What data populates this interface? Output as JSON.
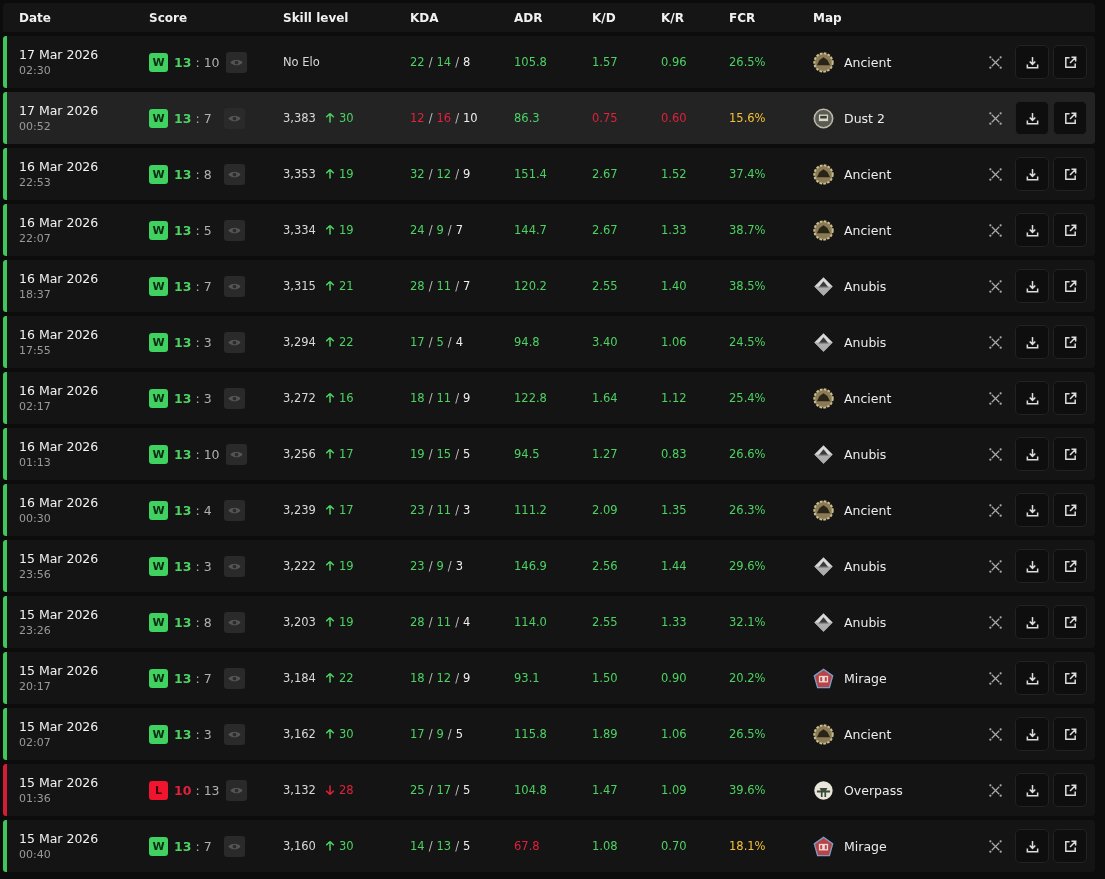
{
  "columns": [
    "Date",
    "Score",
    "Skill level",
    "KDA",
    "ADR",
    "K/D",
    "K/R",
    "FCR",
    "Map"
  ],
  "rows": [
    {
      "selected": false,
      "date": "17 Mar 2026",
      "time": "02:30",
      "result": "W",
      "win": true,
      "score": [
        {
          "text": "13",
          "color": "#4cd263"
        },
        {
          "text": ":"
        },
        {
          "text": "10"
        }
      ],
      "elo": "No Elo",
      "kda": [
        {
          "text": "22",
          "color": "#4cd263"
        },
        {
          "text": "/"
        },
        {
          "text": "14",
          "color": "#4cd263"
        },
        {
          "text": "/"
        },
        {
          "text": "8",
          "color": "#eeeeee"
        }
      ],
      "adr": {
        "text": "105.8",
        "color": "#4cd263"
      },
      "kd": {
        "text": "1.57",
        "color": "#4cd263"
      },
      "kr": {
        "text": "0.96",
        "color": "#4cd263"
      },
      "fcr": {
        "text": "26.5%",
        "color": "#4cd263"
      },
      "map": {
        "name": "Ancient",
        "kind": "ancient"
      }
    },
    {
      "selected": true,
      "date": "17 Mar 2026",
      "time": "00:52",
      "result": "W",
      "win": true,
      "score": [
        {
          "text": "13",
          "color": "#4cd263"
        },
        {
          "text": ":"
        },
        {
          "text": "7"
        }
      ],
      "elo": "3,383",
      "rising": true,
      "change": "30",
      "kda": [
        {
          "text": "12",
          "color": "#e0213d"
        },
        {
          "text": "/"
        },
        {
          "text": "16",
          "color": "#e0213d"
        },
        {
          "text": "/"
        },
        {
          "text": "10",
          "color": "#eeeeee"
        }
      ],
      "adr": {
        "text": "86.3",
        "color": "#4cd263"
      },
      "kd": {
        "text": "0.75",
        "color": "#e0213d"
      },
      "kr": {
        "text": "0.60",
        "color": "#e0213d"
      },
      "fcr": {
        "text": "15.6%",
        "color": "#f4c136"
      },
      "map": {
        "name": "Dust 2",
        "kind": "dust2"
      }
    },
    {
      "selected": false,
      "date": "16 Mar 2026",
      "time": "22:53",
      "result": "W",
      "win": true,
      "score": [
        {
          "text": "13",
          "color": "#4cd263"
        },
        {
          "text": ":"
        },
        {
          "text": "8"
        }
      ],
      "elo": "3,353",
      "rising": true,
      "change": "19",
      "kda": [
        {
          "text": "32",
          "color": "#4cd263"
        },
        {
          "text": "/"
        },
        {
          "text": "12",
          "color": "#4cd263"
        },
        {
          "text": "/"
        },
        {
          "text": "9",
          "color": "#eeeeee"
        }
      ],
      "adr": {
        "text": "151.4",
        "color": "#4cd263"
      },
      "kd": {
        "text": "2.67",
        "color": "#4cd263"
      },
      "kr": {
        "text": "1.52",
        "color": "#4cd263"
      },
      "fcr": {
        "text": "37.4%",
        "color": "#4cd263"
      },
      "map": {
        "name": "Ancient",
        "kind": "ancient"
      }
    },
    {
      "selected": false,
      "date": "16 Mar 2026",
      "time": "22:07",
      "result": "W",
      "win": true,
      "score": [
        {
          "text": "13",
          "color": "#4cd263"
        },
        {
          "text": ":"
        },
        {
          "text": "5"
        }
      ],
      "elo": "3,334",
      "rising": true,
      "change": "19",
      "kda": [
        {
          "text": "24",
          "color": "#4cd263"
        },
        {
          "text": "/"
        },
        {
          "text": "9",
          "color": "#4cd263"
        },
        {
          "text": "/"
        },
        {
          "text": "7",
          "color": "#eeeeee"
        }
      ],
      "adr": {
        "text": "144.7",
        "color": "#4cd263"
      },
      "kd": {
        "text": "2.67",
        "color": "#4cd263"
      },
      "kr": {
        "text": "1.33",
        "color": "#4cd263"
      },
      "fcr": {
        "text": "38.7%",
        "color": "#4cd263"
      },
      "map": {
        "name": "Ancient",
        "kind": "ancient"
      }
    },
    {
      "selected": false,
      "date": "16 Mar 2026",
      "time": "18:37",
      "result": "W",
      "win": true,
      "score": [
        {
          "text": "13",
          "color": "#4cd263"
        },
        {
          "text": ":"
        },
        {
          "text": "7"
        }
      ],
      "elo": "3,315",
      "rising": true,
      "change": "21",
      "kda": [
        {
          "text": "28",
          "color": "#4cd263"
        },
        {
          "text": "/"
        },
        {
          "text": "11",
          "color": "#4cd263"
        },
        {
          "text": "/"
        },
        {
          "text": "7",
          "color": "#eeeeee"
        }
      ],
      "adr": {
        "text": "120.2",
        "color": "#4cd263"
      },
      "kd": {
        "text": "2.55",
        "color": "#4cd263"
      },
      "kr": {
        "text": "1.40",
        "color": "#4cd263"
      },
      "fcr": {
        "text": "38.5%",
        "color": "#4cd263"
      },
      "map": {
        "name": "Anubis",
        "kind": "anubis"
      }
    },
    {
      "selected": false,
      "date": "16 Mar 2026",
      "time": "17:55",
      "result": "W",
      "win": true,
      "score": [
        {
          "text": "13",
          "color": "#4cd263"
        },
        {
          "text": ":"
        },
        {
          "text": "3"
        }
      ],
      "elo": "3,294",
      "rising": true,
      "change": "22",
      "kda": [
        {
          "text": "17",
          "color": "#4cd263"
        },
        {
          "text": "/"
        },
        {
          "text": "5",
          "color": "#4cd263"
        },
        {
          "text": "/"
        },
        {
          "text": "4",
          "color": "#eeeeee"
        }
      ],
      "adr": {
        "text": "94.8",
        "color": "#4cd263"
      },
      "kd": {
        "text": "3.40",
        "color": "#4cd263"
      },
      "kr": {
        "text": "1.06",
        "color": "#4cd263"
      },
      "fcr": {
        "text": "24.5%",
        "color": "#4cd263"
      },
      "map": {
        "name": "Anubis",
        "kind": "anubis"
      }
    },
    {
      "selected": false,
      "date": "16 Mar 2026",
      "time": "02:17",
      "result": "W",
      "win": true,
      "score": [
        {
          "text": "13",
          "color": "#4cd263"
        },
        {
          "text": ":"
        },
        {
          "text": "3"
        }
      ],
      "elo": "3,272",
      "rising": true,
      "change": "16",
      "kda": [
        {
          "text": "18",
          "color": "#4cd263"
        },
        {
          "text": "/"
        },
        {
          "text": "11",
          "color": "#4cd263"
        },
        {
          "text": "/"
        },
        {
          "text": "9",
          "color": "#eeeeee"
        }
      ],
      "adr": {
        "text": "122.8",
        "color": "#4cd263"
      },
      "kd": {
        "text": "1.64",
        "color": "#4cd263"
      },
      "kr": {
        "text": "1.12",
        "color": "#4cd263"
      },
      "fcr": {
        "text": "25.4%",
        "color": "#4cd263"
      },
      "map": {
        "name": "Ancient",
        "kind": "ancient"
      }
    },
    {
      "selected": false,
      "date": "16 Mar 2026",
      "time": "01:13",
      "result": "W",
      "win": true,
      "score": [
        {
          "text": "13",
          "color": "#4cd263"
        },
        {
          "text": ":"
        },
        {
          "text": "10"
        }
      ],
      "elo": "3,256",
      "rising": true,
      "change": "17",
      "kda": [
        {
          "text": "19",
          "color": "#4cd263"
        },
        {
          "text": "/"
        },
        {
          "text": "15",
          "color": "#4cd263"
        },
        {
          "text": "/"
        },
        {
          "text": "5",
          "color": "#eeeeee"
        }
      ],
      "adr": {
        "text": "94.5",
        "color": "#4cd263"
      },
      "kd": {
        "text": "1.27",
        "color": "#4cd263"
      },
      "kr": {
        "text": "0.83",
        "color": "#4cd263"
      },
      "fcr": {
        "text": "26.6%",
        "color": "#4cd263"
      },
      "map": {
        "name": "Anubis",
        "kind": "anubis"
      }
    },
    {
      "selected": false,
      "date": "16 Mar 2026",
      "time": "00:30",
      "result": "W",
      "win": true,
      "score": [
        {
          "text": "13",
          "color": "#4cd263"
        },
        {
          "text": ":"
        },
        {
          "text": "4"
        }
      ],
      "elo": "3,239",
      "rising": true,
      "change": "17",
      "kda": [
        {
          "text": "23",
          "color": "#4cd263"
        },
        {
          "text": "/"
        },
        {
          "text": "11",
          "color": "#4cd263"
        },
        {
          "text": "/"
        },
        {
          "text": "3",
          "color": "#eeeeee"
        }
      ],
      "adr": {
        "text": "111.2",
        "color": "#4cd263"
      },
      "kd": {
        "text": "2.09",
        "color": "#4cd263"
      },
      "kr": {
        "text": "1.35",
        "color": "#4cd263"
      },
      "fcr": {
        "text": "26.3%",
        "color": "#4cd263"
      },
      "map": {
        "name": "Ancient",
        "kind": "ancient"
      }
    },
    {
      "selected": false,
      "date": "15 Mar 2026",
      "time": "23:56",
      "result": "W",
      "win": true,
      "score": [
        {
          "text": "13",
          "color": "#4cd263"
        },
        {
          "text": ":"
        },
        {
          "text": "3"
        }
      ],
      "elo": "3,222",
      "rising": true,
      "change": "19",
      "kda": [
        {
          "text": "23",
          "color": "#4cd263"
        },
        {
          "text": "/"
        },
        {
          "text": "9",
          "color": "#4cd263"
        },
        {
          "text": "/"
        },
        {
          "text": "3",
          "color": "#eeeeee"
        }
      ],
      "adr": {
        "text": "146.9",
        "color": "#4cd263"
      },
      "kd": {
        "text": "2.56",
        "color": "#4cd263"
      },
      "kr": {
        "text": "1.44",
        "color": "#4cd263"
      },
      "fcr": {
        "text": "29.6%",
        "color": "#4cd263"
      },
      "map": {
        "name": "Anubis",
        "kind": "anubis"
      }
    },
    {
      "selected": false,
      "date": "15 Mar 2026",
      "time": "23:26",
      "result": "W",
      "win": true,
      "score": [
        {
          "text": "13",
          "color": "#4cd263"
        },
        {
          "text": ":"
        },
        {
          "text": "8"
        }
      ],
      "elo": "3,203",
      "rising": true,
      "change": "19",
      "kda": [
        {
          "text": "28",
          "color": "#4cd263"
        },
        {
          "text": "/"
        },
        {
          "text": "11",
          "color": "#4cd263"
        },
        {
          "text": "/"
        },
        {
          "text": "4",
          "color": "#eeeeee"
        }
      ],
      "adr": {
        "text": "114.0",
        "color": "#4cd263"
      },
      "kd": {
        "text": "2.55",
        "color": "#4cd263"
      },
      "kr": {
        "text": "1.33",
        "color": "#4cd263"
      },
      "fcr": {
        "text": "32.1%",
        "color": "#4cd263"
      },
      "map": {
        "name": "Anubis",
        "kind": "anubis"
      }
    },
    {
      "selected": false,
      "date": "15 Mar 2026",
      "time": "20:17",
      "result": "W",
      "win": true,
      "score": [
        {
          "text": "13",
          "color": "#4cd263"
        },
        {
          "text": ":"
        },
        {
          "text": "7"
        }
      ],
      "elo": "3,184",
      "rising": true,
      "change": "22",
      "kda": [
        {
          "text": "18",
          "color": "#4cd263"
        },
        {
          "text": "/"
        },
        {
          "text": "12",
          "color": "#4cd263"
        },
        {
          "text": "/"
        },
        {
          "text": "9",
          "color": "#eeeeee"
        }
      ],
      "adr": {
        "text": "93.1",
        "color": "#4cd263"
      },
      "kd": {
        "text": "1.50",
        "color": "#4cd263"
      },
      "kr": {
        "text": "0.90",
        "color": "#4cd263"
      },
      "fcr": {
        "text": "20.2%",
        "color": "#4cd263"
      },
      "map": {
        "name": "Mirage",
        "kind": "mirage"
      }
    },
    {
      "selected": false,
      "date": "15 Mar 2026",
      "time": "02:07",
      "result": "W",
      "win": true,
      "score": [
        {
          "text": "13",
          "color": "#4cd263"
        },
        {
          "text": ":"
        },
        {
          "text": "3"
        }
      ],
      "elo": "3,162",
      "rising": true,
      "change": "30",
      "kda": [
        {
          "text": "17",
          "color": "#4cd263"
        },
        {
          "text": "/"
        },
        {
          "text": "9",
          "color": "#4cd263"
        },
        {
          "text": "/"
        },
        {
          "text": "5",
          "color": "#eeeeee"
        }
      ],
      "adr": {
        "text": "115.8",
        "color": "#4cd263"
      },
      "kd": {
        "text": "1.89",
        "color": "#4cd263"
      },
      "kr": {
        "text": "1.06",
        "color": "#4cd263"
      },
      "fcr": {
        "text": "26.5%",
        "color": "#4cd263"
      },
      "map": {
        "name": "Ancient",
        "kind": "ancient"
      }
    },
    {
      "selected": false,
      "date": "15 Mar 2026",
      "time": "01:36",
      "result": "L",
      "win": false,
      "score": [
        {
          "text": "10",
          "color": "#e0213d"
        },
        {
          "text": ":"
        },
        {
          "text": "13"
        }
      ],
      "elo": "3,132",
      "rising": false,
      "change": "28",
      "kda": [
        {
          "text": "25",
          "color": "#4cd263"
        },
        {
          "text": "/"
        },
        {
          "text": "17",
          "color": "#4cd263"
        },
        {
          "text": "/"
        },
        {
          "text": "5",
          "color": "#eeeeee"
        }
      ],
      "adr": {
        "text": "104.8",
        "color": "#4cd263"
      },
      "kd": {
        "text": "1.47",
        "color": "#4cd263"
      },
      "kr": {
        "text": "1.09",
        "color": "#4cd263"
      },
      "fcr": {
        "text": "39.6%",
        "color": "#4cd263"
      },
      "map": {
        "name": "Overpass",
        "kind": "overpass"
      }
    },
    {
      "selected": false,
      "date": "15 Mar 2026",
      "time": "00:40",
      "result": "W",
      "win": true,
      "score": [
        {
          "text": "13",
          "color": "#4cd263"
        },
        {
          "text": ":"
        },
        {
          "text": "7"
        }
      ],
      "elo": "3,160",
      "rising": true,
      "change": "30",
      "kda": [
        {
          "text": "14",
          "color": "#4cd263"
        },
        {
          "text": "/"
        },
        {
          "text": "13",
          "color": "#4cd263"
        },
        {
          "text": "/"
        },
        {
          "text": "5",
          "color": "#eeeeee"
        }
      ],
      "adr": {
        "text": "67.8",
        "color": "#e0213d"
      },
      "kd": {
        "text": "1.08",
        "color": "#4cd263"
      },
      "kr": {
        "text": "0.70",
        "color": "#4cd263"
      },
      "fcr": {
        "text": "18.1%",
        "color": "#f4c136"
      },
      "map": {
        "name": "Mirage",
        "kind": "mirage"
      }
    }
  ]
}
